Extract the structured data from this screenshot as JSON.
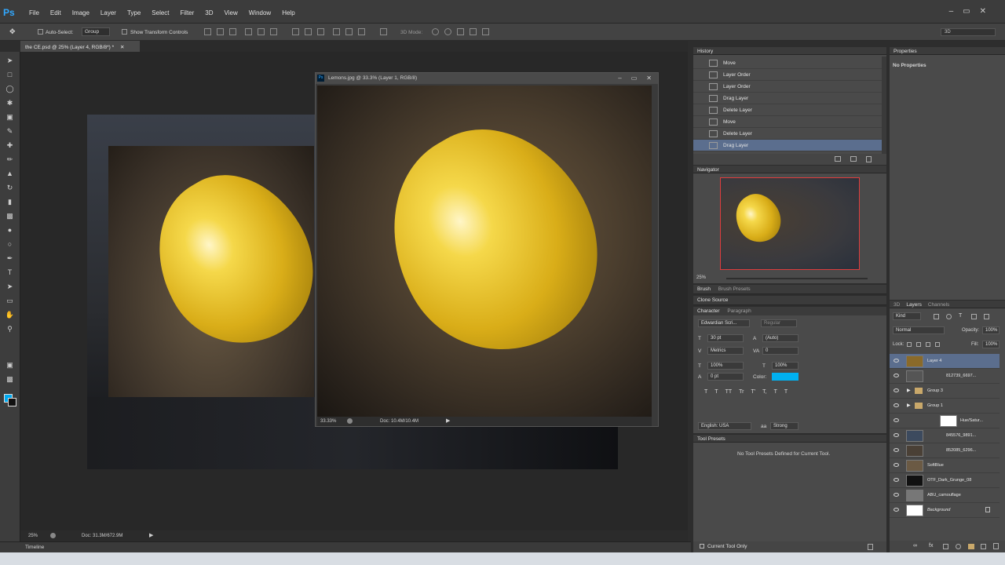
{
  "app": {
    "logo": "Ps"
  },
  "menu": [
    "File",
    "Edit",
    "Image",
    "Layer",
    "Type",
    "Select",
    "Filter",
    "3D",
    "View",
    "Window",
    "Help"
  ],
  "options_bar": {
    "auto_select_label": "Auto-Select:",
    "group_value": "Group",
    "transform_label": "Show Transform Controls",
    "mode_label": "3D Mode:",
    "workspace": "3D"
  },
  "document": {
    "tab": "the CE.psd @ 25% (Layer 4, RGB/8*) *",
    "zoom": "25%",
    "doc_size": "Doc: 31.3M/672.9M"
  },
  "floating_window": {
    "title": "Lemons.jpg @ 33.3% (Layer 1, RGB/8)",
    "zoom": "33.33%",
    "doc_size": "Doc: 10.4M/10.4M"
  },
  "timeline_label": "Timeline",
  "history": {
    "title": "History",
    "items": [
      {
        "label": "Move",
        "active": false
      },
      {
        "label": "Layer Order",
        "active": false
      },
      {
        "label": "Layer Order",
        "active": false
      },
      {
        "label": "Drag Layer",
        "active": false
      },
      {
        "label": "Delete Layer",
        "active": false
      },
      {
        "label": "Move",
        "active": false
      },
      {
        "label": "Delete Layer",
        "active": false
      },
      {
        "label": "Drag Layer",
        "active": true
      }
    ]
  },
  "navigator": {
    "title": "Navigator",
    "zoom": "25%"
  },
  "brush_tabs": [
    "Brush",
    "Brush Presets"
  ],
  "clone_source": "Clone Source",
  "character": {
    "tabs": [
      "Character",
      "Paragraph"
    ],
    "font": "Edwardian Scri...",
    "style": "Regular",
    "size": "30 pt",
    "leading": "(Auto)",
    "kerning": "Metrics",
    "tracking": "0",
    "vscale": "100%",
    "hscale": "100%",
    "baseline": "0 pt",
    "color_label": "Color:",
    "color": "#00b0f0",
    "language": "English: USA",
    "aa": "Strong",
    "type_buttons": [
      "T",
      "T",
      "TT",
      "Tr",
      "T'",
      "T,",
      "T",
      "T"
    ]
  },
  "tool_presets": {
    "title": "Tool Presets",
    "empty": "No Tool Presets Defined for Current Tool.",
    "current_only": "Current Tool Only"
  },
  "properties": {
    "title": "Properties",
    "empty": "No Properties"
  },
  "layers": {
    "tabs": [
      "3D",
      "Layers",
      "Channels"
    ],
    "kind": "Kind",
    "blend": "Normal",
    "opacity_label": "Opacity:",
    "opacity": "100%",
    "lock_label": "Lock:",
    "fill_label": "Fill:",
    "fill": "100%",
    "items": [
      {
        "name": "Layer 4",
        "selected": true,
        "thumb": "#8a6a2a"
      },
      {
        "name": "812739_6697...",
        "selected": false,
        "thumb": "#555"
      },
      {
        "name": "Group 3",
        "selected": false,
        "thumb": ""
      },
      {
        "name": "Group 1",
        "selected": false,
        "thumb": ""
      },
      {
        "name": "Hue/Satur...",
        "selected": false,
        "thumb": "#ffffff"
      },
      {
        "name": "845576_9891...",
        "selected": false,
        "thumb": "#3c4a5e"
      },
      {
        "name": "852085_6296...",
        "selected": false,
        "thumb": "#4a4036"
      },
      {
        "name": "SoftBlue",
        "selected": false,
        "thumb": "#6b5a44"
      },
      {
        "name": "OTF_Dark_Grunge_08",
        "selected": false,
        "thumb": "#111"
      },
      {
        "name": "ABU_camouflage",
        "selected": false,
        "thumb": "#777"
      },
      {
        "name": "Background",
        "selected": false,
        "thumb": "#ffffff"
      }
    ]
  },
  "colors": {
    "foreground": "#00a9f0",
    "background": "#111111",
    "selection": "#5b6e8e"
  }
}
